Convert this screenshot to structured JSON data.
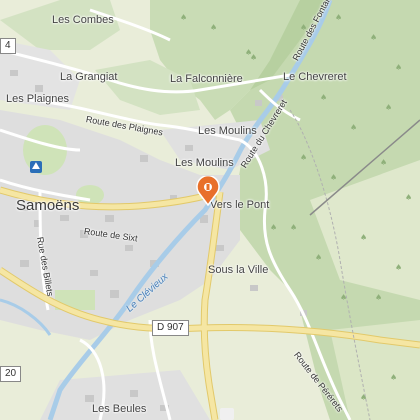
{
  "map": {
    "places": {
      "les_combes": "Les Combes",
      "la_grangiat": "La Grangiat",
      "la_falconniere": "La Falconnière",
      "le_chevreret": "Le Chevreret",
      "les_plaignes": "Les Plaignes",
      "les_moulins_east": "Les Moulins",
      "les_moulins": "Les Moulins",
      "samoens": "Samoëns",
      "vers_le_pont": "Vers le Pont",
      "sous_la_ville": "Sous la Ville",
      "les_beules": "Les Beules"
    },
    "roads": {
      "route_des_plaignes": "Route des Plaignes",
      "route_du_chevreret": "Route du Chevreret",
      "route_des_fontaines": "Route des Fontaines",
      "route_de_sixt": "Route de Sixt",
      "rue_des_billets": "Rue des Billets",
      "route_de_perperets": "Route de Pérérets"
    },
    "river": "Le Clévieux",
    "shields": {
      "d907": "D 907",
      "left_top": "4",
      "left_bottom": "20"
    },
    "marker_icon": "map-pin-icon",
    "tourist_icon": "tourist-info-icon",
    "colors": {
      "forest": "#c9dcb5",
      "meadow": "#e8ecd8",
      "urban": "#dcdcdc",
      "river": "#a8cce8",
      "main_road": "#f5e6a3",
      "pin": "#e8702a"
    }
  }
}
